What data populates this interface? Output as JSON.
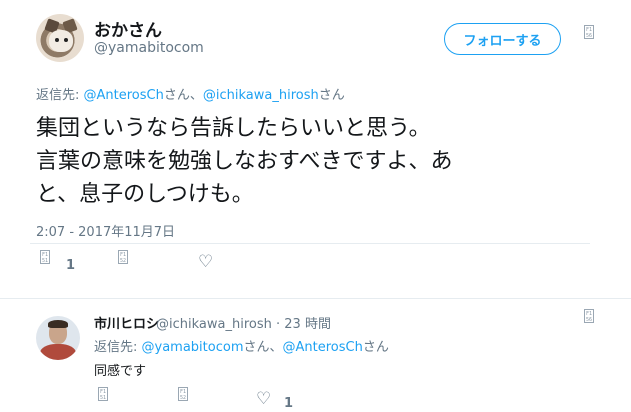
{
  "tweet": {
    "author_name": "おかさん",
    "author_handle": "@yamabitocom",
    "follow_label": "フォローする",
    "reply_to_prefix": "返信先: ",
    "reply_to_user1": "@AnterosCh",
    "reply_to_mid": "さん、",
    "reply_to_user2": "@ichikawa_hirosh",
    "reply_to_suffix": "さん",
    "text_line1": "集団というなら告訴したらいいと思う。",
    "text_line2": "言葉の意味を勉強しなおすべきですよ、あ",
    "text_line3": "と、息子のしつけも。",
    "timestamp": "2:07 - 2017年11月7日",
    "reply_count": "1",
    "like_count": ""
  },
  "reply": {
    "author_name": "市川ヒロシ",
    "author_handle": "@ichikawa_hirosh",
    "dot": "·",
    "age": "23 時間",
    "reply_to_prefix": "返信先: ",
    "reply_to_user1": "@yamabitocom",
    "reply_to_mid": "さん、",
    "reply_to_user2": "@AnterosCh",
    "reply_to_suffix": "さん",
    "text": "同感です",
    "like_count": "1"
  },
  "icons": {
    "placeholder_glyph": "F1 56",
    "placeholder_glyph_reply": "F1 51",
    "placeholder_glyph_retweet": "F1 52",
    "heart": "♡"
  },
  "colors": {
    "accent": "#1da1f2",
    "muted": "#657786",
    "text": "#14171a"
  }
}
